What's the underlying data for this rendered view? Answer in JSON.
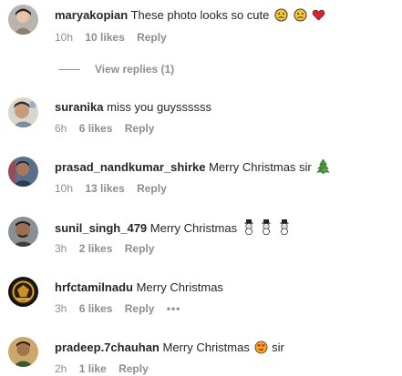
{
  "comments": [
    {
      "username": "maryakopian",
      "text": "These photo looks so cute",
      "time": "10h",
      "likes": "10 likes",
      "reply": "Reply",
      "emojis": [
        "sad-face",
        "sad-face",
        "red-heart"
      ],
      "view_replies": "View replies (1)"
    },
    {
      "username": "suranika",
      "text": "miss you guyssssss",
      "time": "6h",
      "likes": "6 likes",
      "reply": "Reply"
    },
    {
      "username": "prasad_nandkumar_shirke",
      "text": "Merry Christmas sir",
      "time": "10h",
      "likes": "13 likes",
      "reply": "Reply",
      "emojis": [
        "christmas-tree"
      ]
    },
    {
      "username": "sunil_singh_479",
      "text": "Merry Christmas",
      "time": "3h",
      "likes": "2 likes",
      "reply": "Reply",
      "emojis": [
        "snowman",
        "snowman",
        "snowman"
      ]
    },
    {
      "username": "hrfctamilnadu",
      "text": "Merry Christmas",
      "time": "3h",
      "likes": "6 likes",
      "reply": "Reply",
      "more": "•••"
    },
    {
      "username": "pradeep.7chauhan",
      "text": "Merry Christmas",
      "text_after": "sir",
      "time": "2h",
      "likes": "1 like",
      "reply": "Reply",
      "emojis": [
        "heart-eyes-face"
      ]
    }
  ],
  "colors": {
    "text": "#262626",
    "muted": "#8e8e8e"
  }
}
